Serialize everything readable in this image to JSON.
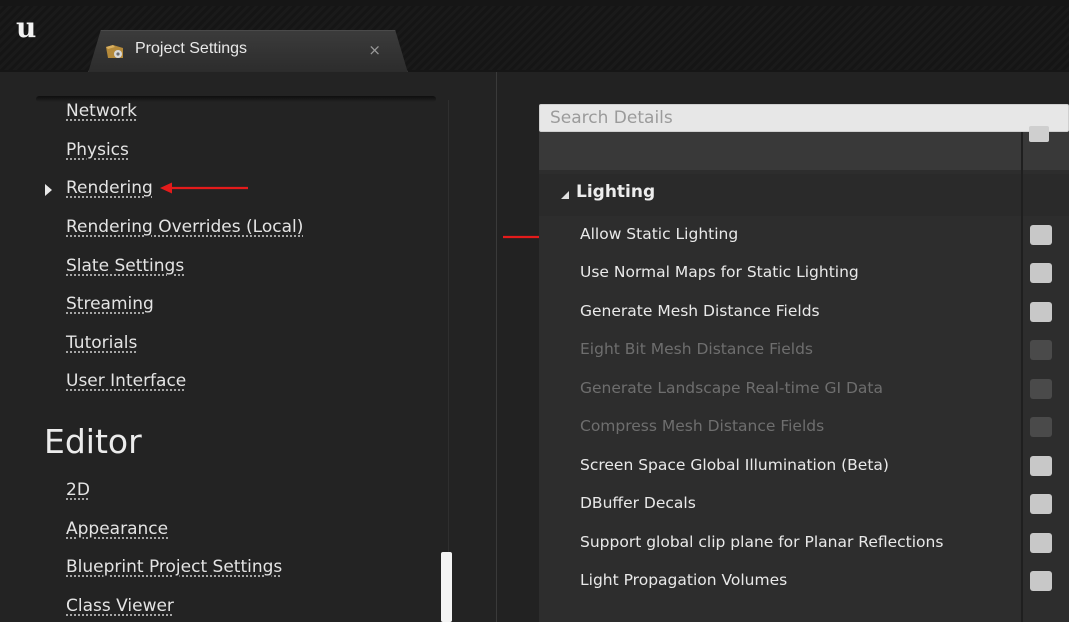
{
  "window": {
    "logo": "u",
    "tab_title": "Project Settings",
    "tab_close": "×",
    "tab_icon": "project-settings-icon"
  },
  "sidebar": {
    "items": [
      {
        "label": "Network"
      },
      {
        "label": "Physics"
      },
      {
        "label": "Rendering",
        "selected": true
      },
      {
        "label": "Rendering Overrides (Local)"
      },
      {
        "label": "Slate Settings"
      },
      {
        "label": "Streaming"
      },
      {
        "label": "Tutorials"
      },
      {
        "label": "User Interface"
      }
    ],
    "section_title": "Editor",
    "editor_items": [
      {
        "label": "2D"
      },
      {
        "label": "Appearance"
      },
      {
        "label": "Blueprint Project Settings"
      },
      {
        "label": "Class Viewer"
      }
    ]
  },
  "details": {
    "search_placeholder": "Search Details",
    "section_header": "Lighting",
    "properties": [
      {
        "label": "Allow Static Lighting",
        "enabled": true
      },
      {
        "label": "Use Normal Maps for Static Lighting",
        "enabled": true
      },
      {
        "label": "Generate Mesh Distance Fields",
        "enabled": true
      },
      {
        "label": "Eight Bit Mesh Distance Fields",
        "enabled": false
      },
      {
        "label": "Generate Landscape Real-time GI Data",
        "enabled": false
      },
      {
        "label": "Compress Mesh Distance Fields",
        "enabled": false
      },
      {
        "label": "Screen Space Global Illumination (Beta)",
        "enabled": true
      },
      {
        "label": "DBuffer Decals",
        "enabled": true
      },
      {
        "label": "Support global clip plane for Planar Reflections",
        "enabled": true
      },
      {
        "label": "Light Propagation Volumes",
        "enabled": true
      }
    ]
  },
  "colors": {
    "annotation_arrow": "#e41b1b",
    "checkbox_enabled": "#c8c8c8",
    "checkbox_disabled": "#4a4a4a"
  }
}
